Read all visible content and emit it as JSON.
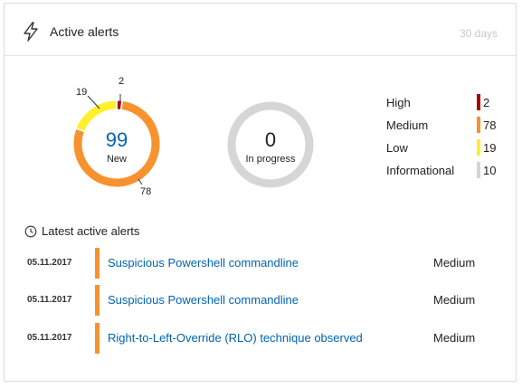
{
  "header": {
    "title": "Active alerts",
    "period": "30 days",
    "icon": "lightning-bolt-icon"
  },
  "new_donut": {
    "value": "99",
    "label": "New",
    "segments": [
      {
        "severity": "High",
        "count": 2,
        "color": "#a80000"
      },
      {
        "severity": "Medium",
        "count": 78,
        "color": "#f7922e"
      },
      {
        "severity": "Low",
        "count": 19,
        "color": "#fef02a"
      },
      {
        "severity": "Informational",
        "count": 0,
        "color": "#d4d4d4"
      }
    ],
    "callouts": {
      "high": "2",
      "low": "19",
      "medium": "78"
    }
  },
  "progress_donut": {
    "value": "0",
    "label": "In progress",
    "color": "#d6d6d6"
  },
  "legend": [
    {
      "name": "High",
      "count": "2",
      "color": "#a80000"
    },
    {
      "name": "Medium",
      "count": "78",
      "color": "#f7922e"
    },
    {
      "name": "Low",
      "count": "19",
      "color": "#fef02a"
    },
    {
      "name": "Informational",
      "count": "10",
      "color": "#d4d4d4"
    }
  ],
  "latest": {
    "title": "Latest active alerts",
    "icon": "clock-icon",
    "rows": [
      {
        "date": "05.11.2017",
        "name": "Suspicious Powershell commandline",
        "severity": "Medium",
        "color": "#f7922e"
      },
      {
        "date": "05.11.2017",
        "name": "Suspicious Powershell commandline",
        "severity": "Medium",
        "color": "#f7922e"
      },
      {
        "date": "05.11.2017",
        "name": "Right-to-Left-Override (RLO) technique observed",
        "severity": "Medium",
        "color": "#f7922e"
      }
    ]
  }
}
